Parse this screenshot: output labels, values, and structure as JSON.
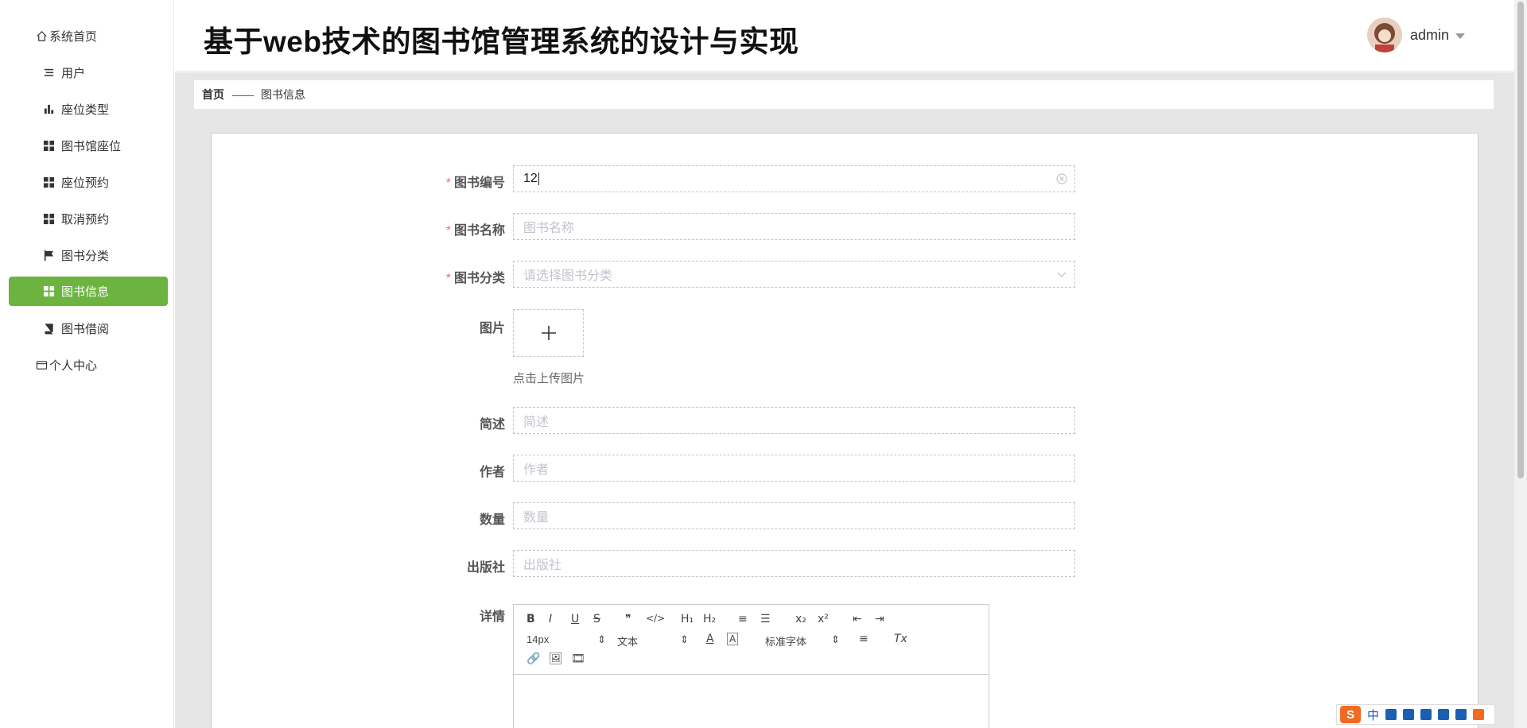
{
  "sidebar": {
    "items": [
      {
        "label": "系统首页",
        "icon": "home-icon"
      },
      {
        "label": "用户",
        "icon": "list-icon"
      },
      {
        "label": "座位类型",
        "icon": "bar-chart-icon"
      },
      {
        "label": "图书馆座位",
        "icon": "grid-icon"
      },
      {
        "label": "座位预约",
        "icon": "grid-icon"
      },
      {
        "label": "取消预约",
        "icon": "grid-icon"
      },
      {
        "label": "图书分类",
        "icon": "flag-icon"
      },
      {
        "label": "图书信息",
        "icon": "grid-icon"
      },
      {
        "label": "图书借阅",
        "icon": "book-icon"
      },
      {
        "label": "个人中心",
        "icon": "card-icon"
      }
    ],
    "active_index": 7,
    "active_color": "#6cb33f"
  },
  "header": {
    "title": "基于web技术的图书馆管理系统的设计与实现",
    "user": "admin"
  },
  "breadcrumb": {
    "home": "首页",
    "separator": "——",
    "current": "图书信息"
  },
  "form": {
    "book_no": {
      "label": "图书编号",
      "value": "12",
      "required": true
    },
    "book_name": {
      "label": "图书名称",
      "placeholder": "图书名称",
      "required": true
    },
    "book_category": {
      "label": "图书分类",
      "placeholder": "请选择图书分类",
      "required": true
    },
    "image": {
      "label": "图片",
      "hint": "点击上传图片"
    },
    "summary": {
      "label": "简述",
      "placeholder": "简述"
    },
    "author": {
      "label": "作者",
      "placeholder": "作者"
    },
    "quantity": {
      "label": "数量",
      "placeholder": "数量"
    },
    "publisher": {
      "label": "出版社",
      "placeholder": "出版社"
    },
    "details": {
      "label": "详情"
    }
  },
  "editor": {
    "toolbar_row1": [
      "B",
      "I",
      "U",
      "S",
      "❞",
      "</>",
      "H₁",
      "H₂",
      "≡",
      "☰",
      "x₂",
      "x²",
      "⇤",
      "⇥"
    ],
    "font_size": "14px",
    "header_select": "文本",
    "font_family": "标准字体",
    "clear_format": "Tx"
  },
  "ime": {
    "logo": "S",
    "mode": "中"
  }
}
